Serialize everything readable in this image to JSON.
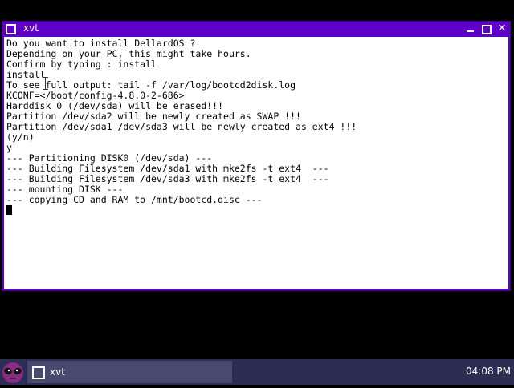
{
  "window": {
    "title": "xvt",
    "min_icon": "minimize-icon",
    "max_icon": "maximize-icon",
    "close_glyph": "✕",
    "accent_color": "#5f00c9"
  },
  "terminal": {
    "lines": [
      "Do you want to install DellardOS ?",
      "Depending on your PC, this might take hours.",
      "Confirm by typing : install",
      "install",
      "To see full output: tail -f /var/log/bootcd2disk.log",
      "KCONF=</boot/config-4.8.0-2-686>",
      "Harddisk 0 (/dev/sda) will be erased!!!",
      "Partition /dev/sda2 will be newly created as SWAP !!!",
      "Partition /dev/sda1 /dev/sda3 will be newly created as ext4 !!!",
      "(y/n)",
      "y",
      "--- Partitioning DISK0 (/dev/sda) ---",
      "--- Building Filesystem /dev/sda1 with mke2fs -t ext4  ---",
      "--- Building Filesystem /dev/sda3 with mke2fs -t ext4  ---",
      "--- mounting DISK ---",
      "--- copying CD and RAM to /mnt/bootcd.disc ---"
    ]
  },
  "taskbar": {
    "start_icon": "alien-face-icon",
    "task_label": "xvt",
    "clock": "04:08 PM",
    "background": "#2b2d53"
  }
}
